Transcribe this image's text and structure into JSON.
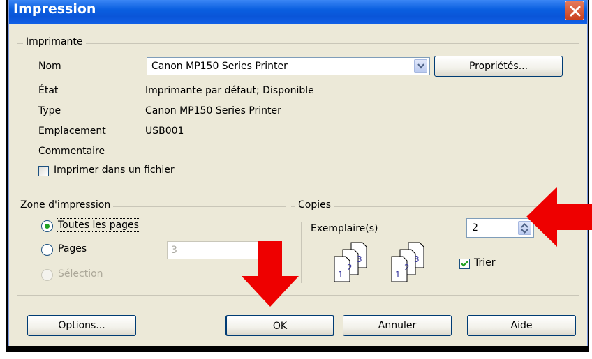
{
  "window": {
    "title": "Impression"
  },
  "printer": {
    "group_label": "Imprimante",
    "name_label": "Nom",
    "name_value": "Canon MP150 Series Printer",
    "properties_button": "Propriétés...",
    "state_label": "État",
    "state_value": "Imprimante par défaut; Disponible",
    "type_label": "Type",
    "type_value": "Canon MP150 Series Printer",
    "location_label": "Emplacement",
    "location_value": "USB001",
    "comment_label": "Commentaire",
    "print_to_file_label": "Imprimer dans un fichier",
    "print_to_file_checked": false
  },
  "range": {
    "group_label": "Zone d'impression",
    "all_pages_label": "Toutes les pages",
    "pages_label": "Pages",
    "pages_value": "3",
    "selection_label": "Sélection",
    "selected": "all"
  },
  "copies": {
    "group_label": "Copies",
    "count_label": "Exemplaire(s)",
    "count_value": "2",
    "collate_label": "Trier",
    "collate_checked": true,
    "doc_page_labels": [
      "1",
      "2",
      "3"
    ]
  },
  "buttons": {
    "options": "Options...",
    "ok": "OK",
    "cancel": "Annuler",
    "help": "Aide"
  },
  "colors": {
    "titlebar": "#0a5fe0",
    "dialog_bg": "#ece9d8",
    "annotation_arrow": "#ee0000",
    "radio_selected": "#21a121"
  }
}
